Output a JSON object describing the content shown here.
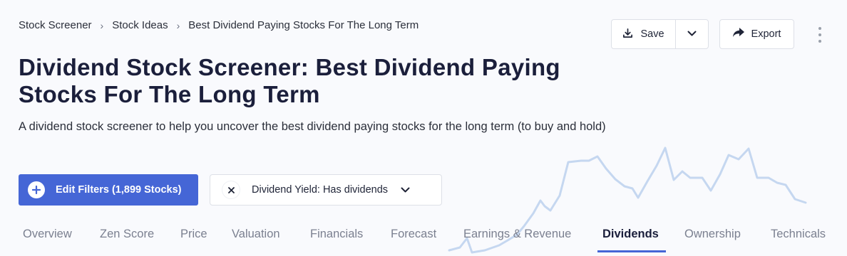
{
  "breadcrumb": {
    "items": [
      "Stock Screener",
      "Stock Ideas",
      "Best Dividend Paying Stocks For The Long Term"
    ],
    "separator": "›"
  },
  "header": {
    "title": "Dividend Stock Screener: Best Dividend Paying Stocks For The Long Term",
    "description": "A dividend stock screener to help you uncover the best dividend paying stocks for the long term (to buy and hold)"
  },
  "actions": {
    "save_label": "Save",
    "export_label": "Export",
    "save_icon": "download-icon",
    "dropdown_icon": "chevron-down-icon",
    "export_icon": "share-arrow-icon",
    "more_icon": "kebab-menu-icon"
  },
  "filters": {
    "edit_label": "Edit Filters (1,899 Stocks)",
    "edit_icon": "plus-circle-icon",
    "chips": [
      {
        "label": "Dividend Yield: Has dividends",
        "remove_icon": "close-icon",
        "expand_icon": "chevron-down-icon"
      }
    ]
  },
  "tabs": {
    "items": [
      "Overview",
      "Zen Score",
      "Price",
      "Valuation",
      "Financials",
      "Forecast",
      "Earnings & Revenue",
      "Dividends",
      "Ownership",
      "Technicals"
    ],
    "active": "Dividends"
  },
  "colors": {
    "accent": "#4566d6",
    "background": "#f9fafd",
    "text": "#1b1f3b",
    "muted_text": "#7b8090",
    "decorative_line": "#c5d7f0"
  }
}
